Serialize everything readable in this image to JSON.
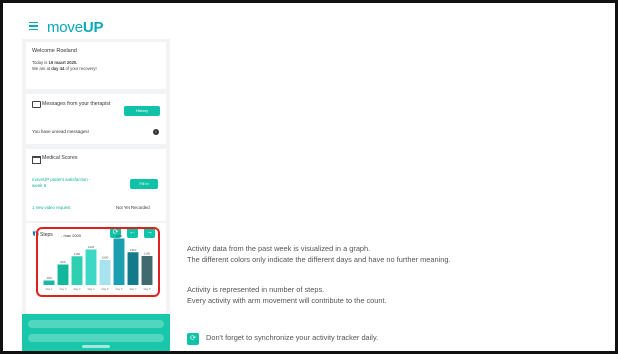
{
  "app": {
    "logo_prefix": "move",
    "logo_suffix": "UP",
    "status_line": "· ·"
  },
  "welcome": {
    "greeting": "Welcome Roeland",
    "today_prefix": "Today is ",
    "today_date": "16 maart 2020.",
    "recovery_prefix": "We are at ",
    "recovery_day": "day 44",
    "recovery_suffix": " of your recovery!"
  },
  "messages": {
    "title": "Messages from your therapist",
    "history_button": "History",
    "unread_text": "You have unread messages!",
    "info_icon": "i"
  },
  "medical_scores": {
    "title": "Medical Scores",
    "survey_label": "moveUP patient satisfaction - week 6",
    "fill_in_button": "Fill in",
    "video_request": "1 new video request",
    "video_status": "Not Yet Recorded"
  },
  "steps": {
    "label": "Steps",
    "max_text": "- max 2000",
    "sync_icon": "⟳",
    "prev_icon": "←",
    "next_icon": "→"
  },
  "chart_data": {
    "type": "bar",
    "categories": [
      "Day 1",
      "Day 2",
      "Day 3",
      "Day 4",
      "Day 5",
      "Day 6",
      "Day 7",
      "Day 8"
    ],
    "values": [
      180,
      820,
      1150,
      1420,
      1000,
      1860,
      1310,
      1160
    ],
    "value_labels": [
      "180",
      "820",
      "1150",
      "1420",
      "1000",
      "1860",
      "1310",
      "1160"
    ],
    "colors": [
      "#1ab8a5",
      "#13b89c",
      "#2fcfb2",
      "#3dd7c6",
      "#a7e3ef",
      "#1a9fb0",
      "#127a8a",
      "#3f6b70"
    ],
    "ylim": [
      0,
      2000
    ],
    "grid": false
  },
  "annotations": {
    "line1": "Activity data from the past week is visualized in a graph.",
    "line2": "The different colors only indicate the different days and have no further meaning.",
    "line3": "Activity is represented in number of steps.",
    "line4": "Every activity with arm movement will contribute to the count.",
    "line5": "Don't forget to synchronize your activity tracker daily.",
    "sync_icon": "⟳"
  },
  "colors": {
    "brand": "#0aa8b8",
    "accent": "#10c2a7",
    "highlight": "#e0201f"
  }
}
